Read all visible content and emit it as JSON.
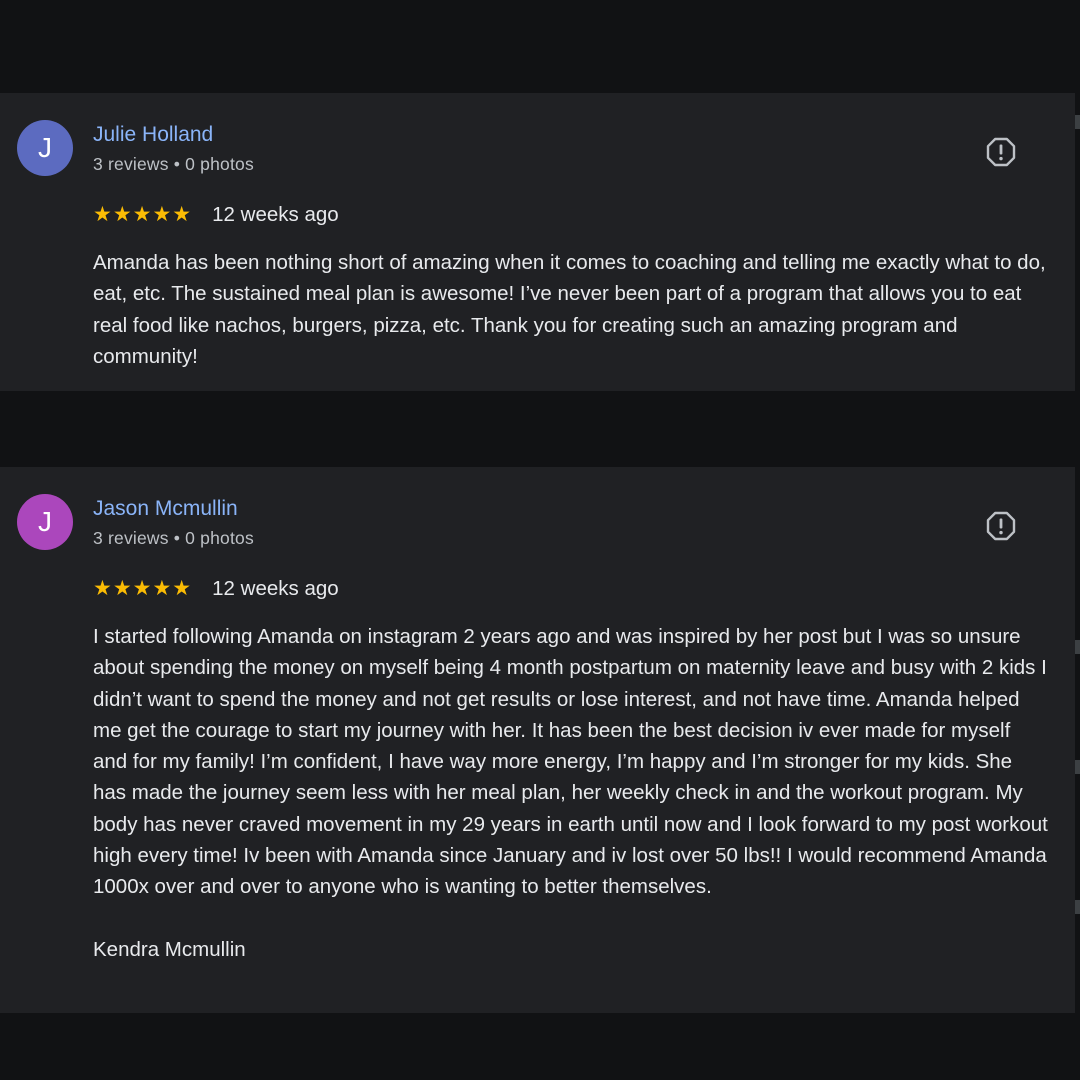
{
  "reviews": [
    {
      "avatar_letter": "J",
      "avatar_color": "#5c6bc0",
      "name": "Julie Holland",
      "meta": "3 reviews • 0 photos",
      "stars": "★★★★★",
      "rating": 5,
      "time_ago": "12 weeks ago",
      "text": "Amanda has been nothing short of amazing when it comes to coaching and telling me exactly what to do, eat, etc. The sustained meal plan is awesome! I’ve never been part of a program that allows you to eat real food like nachos, burgers, pizza, etc. Thank you for creating such an amazing program and community!",
      "flag_icon": "report-flag-icon"
    },
    {
      "avatar_letter": "J",
      "avatar_color": "#ab47bc",
      "name": "Jason Mcmullin",
      "meta": "3 reviews • 0 photos",
      "stars": "★★★★★",
      "rating": 5,
      "time_ago": "12 weeks ago",
      "text": "I started following Amanda on instagram 2 years ago and was inspired by her post but I was so unsure about spending the money on myself being 4 month postpartum on maternity leave and busy with 2 kids I didn’t want to spend the money and not get results or lose interest, and not have time. Amanda helped me get the courage to start my journey with her. It has been the best decision iv ever made for myself and for my family! I’m confident, I have way more energy, I’m happy and I’m stronger for my kids. She has made the journey seem less with her meal plan, her weekly check in and the workout program. My body has never craved movement in my 29 years in earth until now and I look forward to my post workout high every time! Iv been with Amanda since January and iv lost over 50 lbs!! I would recommend Amanda 1000x over and over to anyone who is wanting to better themselves.\n\nKendra Mcmullin",
      "flag_icon": "report-flag-icon"
    }
  ]
}
